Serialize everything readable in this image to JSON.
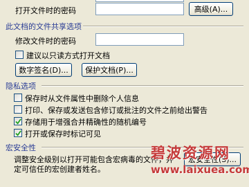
{
  "file_encryption": {
    "open_password_label": "打开文件时的密码",
    "advanced_button": "高级(A)..."
  },
  "sharing_options": {
    "title": "此文档的文件共享选项",
    "modify_password_label": "修改文件时的密码",
    "read_only_label": "建议以只读方式打开文档",
    "read_only_checked": false,
    "digital_signature_button": "数字签名(D)...",
    "protect_document_button": "保护文档(P)..."
  },
  "privacy": {
    "title": "隐私选项",
    "options": [
      {
        "label": "保存时从文件属性中删除个人信息",
        "checked": false
      },
      {
        "label": "打印、保存或发送包含修订或批注的文件之前给出警告",
        "checked": false
      },
      {
        "label": "存储用于增强合并精确性的随机编号",
        "checked": true
      },
      {
        "label": "打开或保存时标记可见",
        "checked": true
      }
    ]
  },
  "macro_security": {
    "title": "宏安全性",
    "description_line1": "调整安全级别以打开可能包含宏病毒的文件，并",
    "description_line2": "定可信任的宏创建者姓名。",
    "button": "宏安全性(S)..."
  },
  "watermark": {
    "site_name": "碧波资源网",
    "url": "www.laixuea.com"
  }
}
